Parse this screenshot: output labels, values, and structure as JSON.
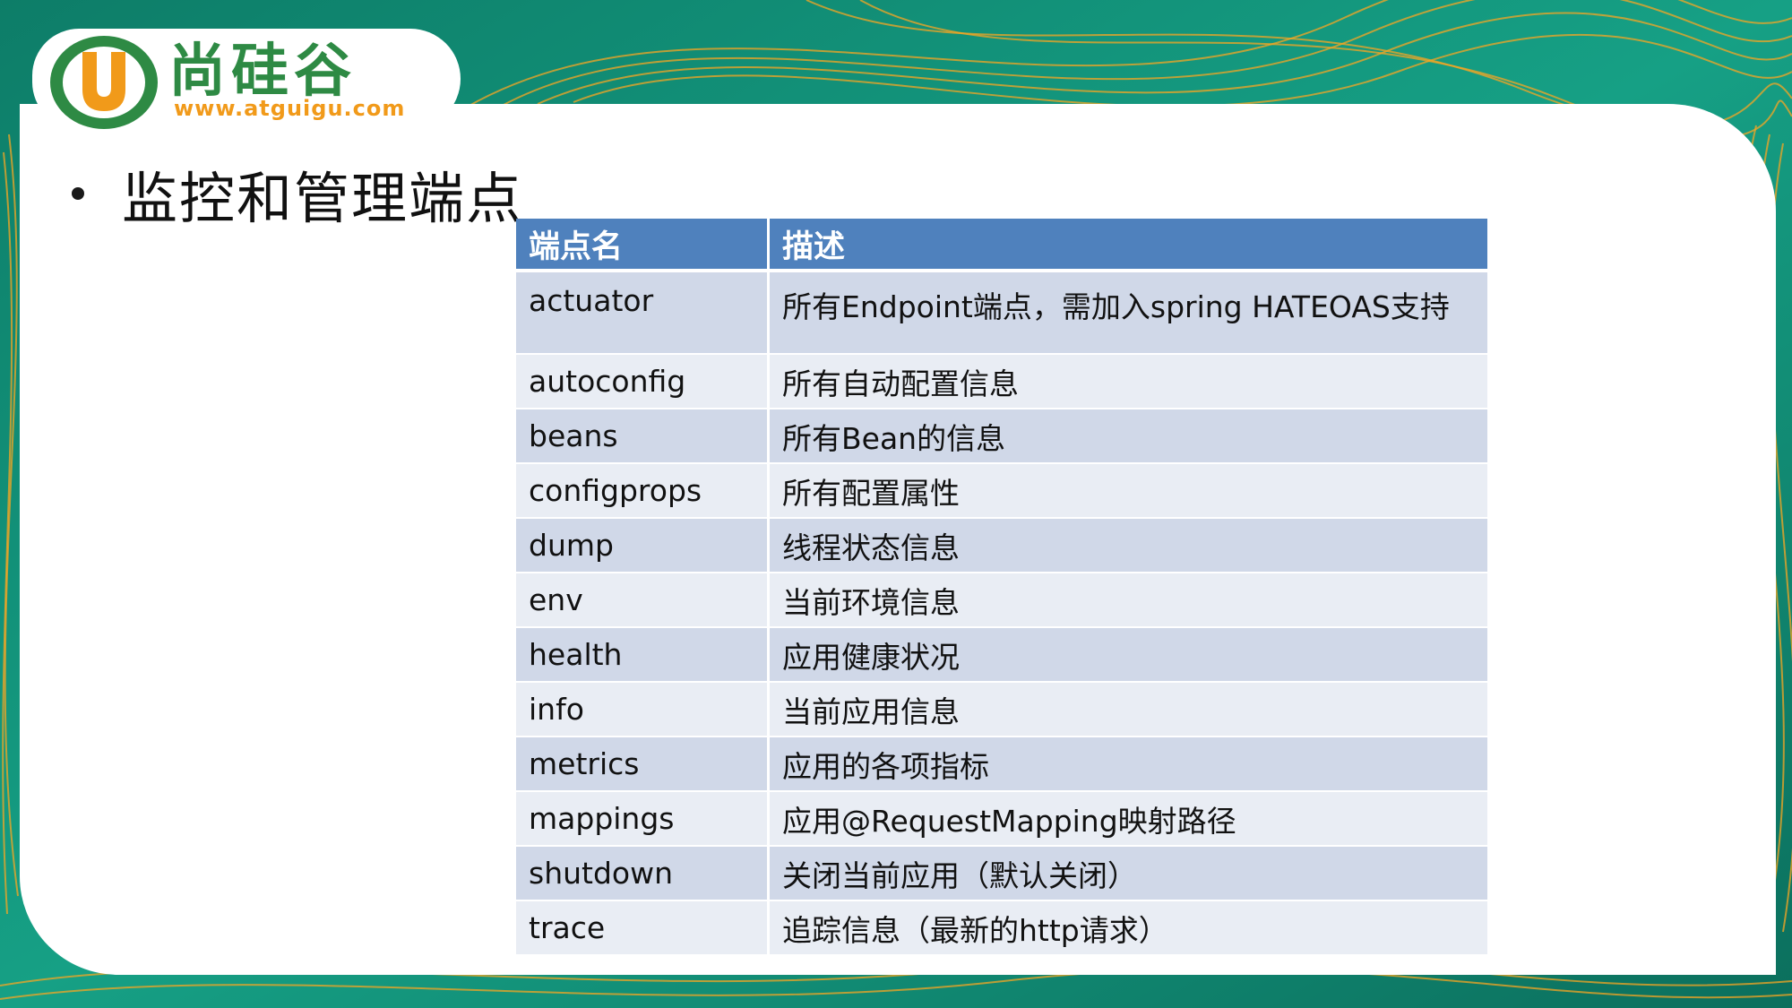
{
  "brand": {
    "logo_cn": "尚硅谷",
    "logo_url": "www.atguigu.com",
    "colors": {
      "green": "#2e8a44",
      "orange": "#f19a1a",
      "header_blue": "#4f81bd"
    }
  },
  "slide": {
    "title": "监控和管理端点"
  },
  "table": {
    "headers": [
      "端点名",
      "描述"
    ],
    "rows": [
      {
        "name": "actuator",
        "desc": "所有Endpoint端点，需加入spring HATEOAS支持"
      },
      {
        "name": "autoconfig",
        "desc": "所有自动配置信息"
      },
      {
        "name": "beans",
        "desc": "所有Bean的信息"
      },
      {
        "name": "configprops",
        "desc": "所有配置属性"
      },
      {
        "name": "dump",
        "desc": "线程状态信息"
      },
      {
        "name": "env",
        "desc": "当前环境信息"
      },
      {
        "name": "health",
        "desc": "应用健康状况"
      },
      {
        "name": "info",
        "desc": "当前应用信息"
      },
      {
        "name": "metrics",
        "desc": "应用的各项指标"
      },
      {
        "name": "mappings",
        "desc": "应用@RequestMapping映射路径"
      },
      {
        "name": "shutdown",
        "desc": "关闭当前应用（默认关闭）"
      },
      {
        "name": "trace",
        "desc": "追踪信息（最新的http请求）"
      }
    ]
  }
}
